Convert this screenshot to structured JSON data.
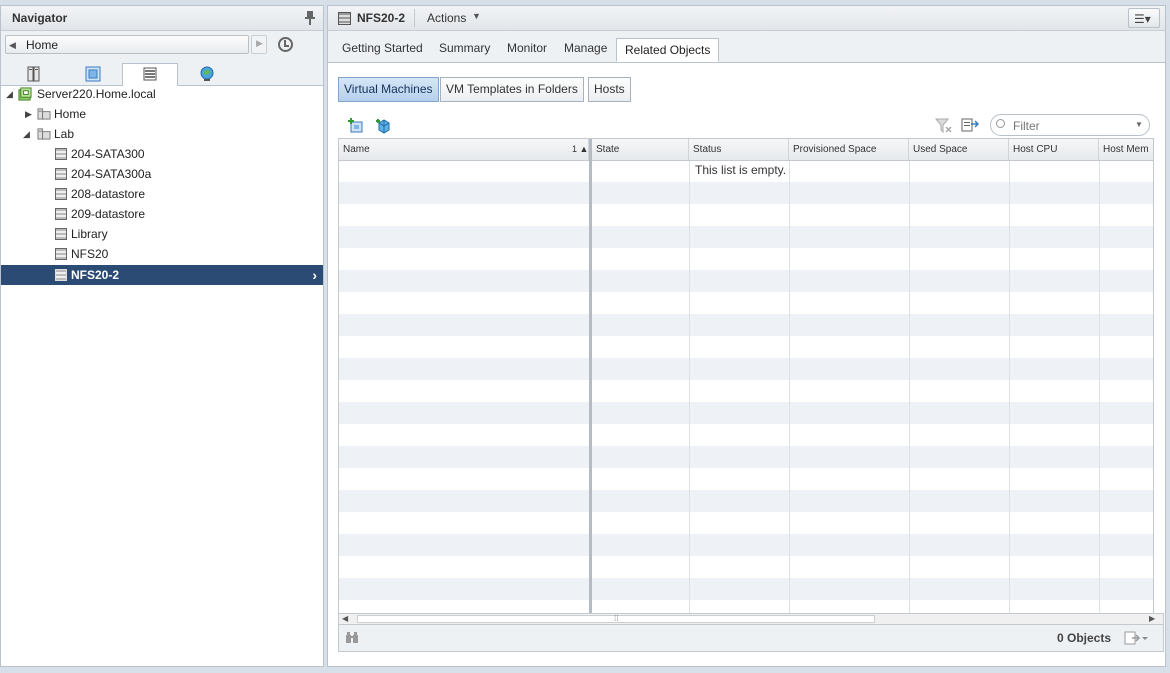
{
  "navigator": {
    "title": "Navigator",
    "home_label": "Home",
    "tree": [
      {
        "label": "Server220.Home.local",
        "kind": "datacenter",
        "depth": 0,
        "expanded": true
      },
      {
        "label": "Home",
        "kind": "folder",
        "depth": 1,
        "expanded": false
      },
      {
        "label": "Lab",
        "kind": "folder",
        "depth": 1,
        "expanded": true
      },
      {
        "label": "204-SATA300",
        "kind": "datastore",
        "depth": 2
      },
      {
        "label": "204-SATA300a",
        "kind": "datastore",
        "depth": 2
      },
      {
        "label": "208-datastore",
        "kind": "datastore",
        "depth": 2
      },
      {
        "label": "209-datastore",
        "kind": "datastore",
        "depth": 2
      },
      {
        "label": "Library",
        "kind": "datastore",
        "depth": 2
      },
      {
        "label": "NFS20",
        "kind": "datastore",
        "depth": 2
      },
      {
        "label": "NFS20-2",
        "kind": "datastore",
        "depth": 2,
        "selected": true
      }
    ]
  },
  "header": {
    "object_name": "NFS20-2",
    "actions_label": "Actions"
  },
  "tabs": [
    "Getting Started",
    "Summary",
    "Monitor",
    "Manage",
    "Related Objects"
  ],
  "subtabs": [
    "Virtual Machines",
    "VM Templates in Folders",
    "Hosts"
  ],
  "filter": {
    "placeholder": "Filter"
  },
  "grid": {
    "columns": [
      "Name",
      "State",
      "Status",
      "Provisioned Space",
      "Used Space",
      "Host CPU",
      "Host Mem"
    ],
    "sort_indicator": "1 ▲",
    "empty_message": "This list is empty."
  },
  "footer": {
    "count": "0 Objects"
  },
  "colors": {
    "selection": "#2b4b75",
    "active_subtab": "#b5d0ec",
    "accent_text": "#14325a"
  }
}
